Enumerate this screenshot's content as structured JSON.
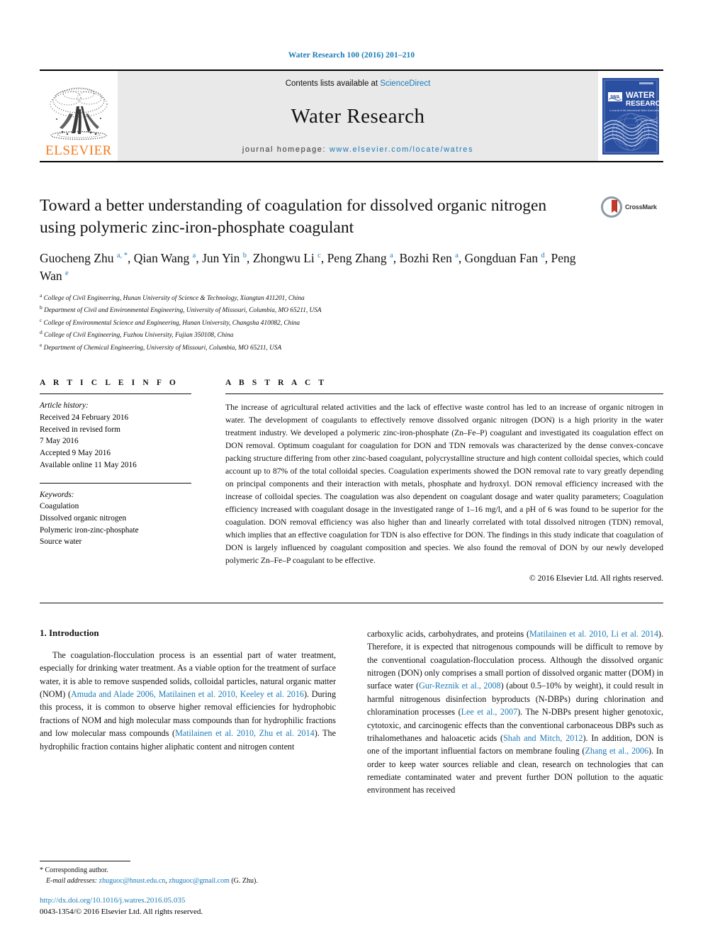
{
  "running_head": "Water Research 100 (2016) 201–210",
  "masthead": {
    "publisher_name": "ELSEVIER",
    "contents_prefix": "Contents lists available at ",
    "contents_link": "ScienceDirect",
    "journal_name": "Water Research",
    "homepage_label": "journal homepage: ",
    "homepage_url": "www.elsevier.com/locate/watres",
    "cover_iwa": "IWA",
    "cover_title_line1": "WATER",
    "cover_title_line2": "RESEARCH",
    "cover_subtitle": "A Journal of the International Water Association"
  },
  "article": {
    "title": "Toward a better understanding of coagulation for dissolved organic nitrogen using polymeric zinc-iron-phosphate coagulant",
    "crossmark_label": "CrossMark",
    "authors_html": "Guocheng Zhu <sup>a, *</sup>, Qian Wang <sup>a</sup>, Jun Yin <sup>b</sup>, Zhongwu Li <sup>c</sup>, Peng Zhang <sup>a</sup>, Bozhi Ren <sup>a</sup>, Gongduan Fan <sup>d</sup>, Peng Wan <sup>e</sup>",
    "affiliations": [
      {
        "mark": "a",
        "text": "College of Civil Engineering, Hunan University of Science & Technology, Xiangtan 411201, China"
      },
      {
        "mark": "b",
        "text": "Department of Civil and Environmental Engineering, University of Missouri, Columbia, MO 65211, USA"
      },
      {
        "mark": "c",
        "text": "College of Environmental Science and Engineering, Hunan University, Changsha 410082, China"
      },
      {
        "mark": "d",
        "text": "College of Civil Engineering, Fuzhou University, Fujian 350108, China"
      },
      {
        "mark": "e",
        "text": "Department of Chemical Engineering, University of Missouri, Columbia, MO 65211, USA"
      }
    ]
  },
  "article_info": {
    "heading": "A R T I C L E  I N F O",
    "history_label": "Article history:",
    "history": [
      "Received 24 February 2016",
      "Received in revised form",
      "7 May 2016",
      "Accepted 9 May 2016",
      "Available online 11 May 2016"
    ],
    "keywords_label": "Keywords:",
    "keywords": [
      "Coagulation",
      "Dissolved organic nitrogen",
      "Polymeric iron-zinc-phosphate",
      "Source water"
    ]
  },
  "abstract": {
    "heading": "A B S T R A C T",
    "text": "The increase of agricultural related activities and the lack of effective waste control has led to an increase of organic nitrogen in water. The development of coagulants to effectively remove dissolved organic nitrogen (DON) is a high priority in the water treatment industry. We developed a polymeric zinc-iron-phosphate (Zn–Fe–P) coagulant and investigated its coagulation effect on DON removal. Optimum coagulant for coagulation for DON and TDN removals was characterized by the dense convex-concave packing structure differing from other zinc-based coagulant, polycrystalline structure and high content colloidal species, which could account up to 87% of the total colloidal species. Coagulation experiments showed the DON removal rate to vary greatly depending on principal components and their interaction with metals, phosphate and hydroxyl. DON removal efficiency increased with the increase of colloidal species. The coagulation was also dependent on coagulant dosage and water quality parameters; Coagulation efficiency increased with coagulant dosage in the investigated range of 1–16 mg/l, and a pH of 6 was found to be superior for the coagulation. DON removal efficiency was also higher than and linearly correlated with total dissolved nitrogen (TDN) removal, which implies that an effective coagulation for TDN is also effective for DON. The findings in this study indicate that coagulation of DON is largely influenced by coagulant composition and species. We also found the removal of DON by our newly developed polymeric Zn–Fe–P coagulant to be effective.",
    "copyright": "© 2016 Elsevier Ltd. All rights reserved."
  },
  "introduction": {
    "heading": "1. Introduction",
    "left_col_html": "The coagulation-flocculation process is an essential part of water treatment, especially for drinking water treatment. As a viable option for the treatment of surface water, it is able to remove suspended solids, colloidal particles, natural organic matter (NOM) (<span class=\"cite\">Amuda and Alade 2006, Matilainen et al. 2010, Keeley et al. 2016</span>). During this process, it is common to observe higher removal efficiencies for hydrophobic fractions of NOM and high molecular mass compounds than for hydrophilic fractions and low molecular mass compounds (<span class=\"cite\">Matilainen et al. 2010, Zhu et al. 2014</span>). The hydrophilic fraction contains higher aliphatic content and nitrogen content",
    "right_col_html": "carboxylic acids, carbohydrates, and proteins (<span class=\"cite\">Matilainen et al. 2010, Li et al. 2014</span>). Therefore, it is expected that nitrogenous compounds will be difficult to remove by the conventional coagulation-flocculation process. Although the dissolved organic nitrogen (DON) only comprises a small portion of dissolved organic matter (DOM) in surface water (<span class=\"cite\">Gur-Reznik et al., 2008</span>) (about 0.5–10% by weight), it could result in harmful nitrogenous disinfection byproducts (N-DBPs) during chlorination and chloramination processes (<span class=\"cite\">Lee et al., 2007</span>). The N-DBPs present higher genotoxic, cytotoxic, and carcinogenic effects than the conventional carbonaceous DBPs such as trihalomethanes and haloacetic acids (<span class=\"cite\">Shah and Mitch, 2012</span>). In addition, DON is one of the important influential factors on membrane fouling (<span class=\"cite\">Zhang et al., 2006</span>). In order to keep water sources reliable and clean, research on technologies that can remediate contaminated water and prevent further DON pollution to the aquatic environment has received"
  },
  "footnotes": {
    "corresponding_mark": "*",
    "corresponding_text": "Corresponding author.",
    "email_label": "E-mail addresses:",
    "email_1": "zhuguoc@hnust.edu.cn",
    "email_sep": ", ",
    "email_2": "zhuguoc@gmail.com",
    "email_suffix": " (G. Zhu).",
    "doi": "http://dx.doi.org/10.1016/j.watres.2016.05.035",
    "issn_line": "0043-1354/© 2016 Elsevier Ltd. All rights reserved."
  },
  "colors": {
    "link_blue": "#1a7bb9",
    "elsevier_orange": "#f47b20",
    "band_gray": "#e9e9e9",
    "cover_blue": "#2b4fa0"
  }
}
